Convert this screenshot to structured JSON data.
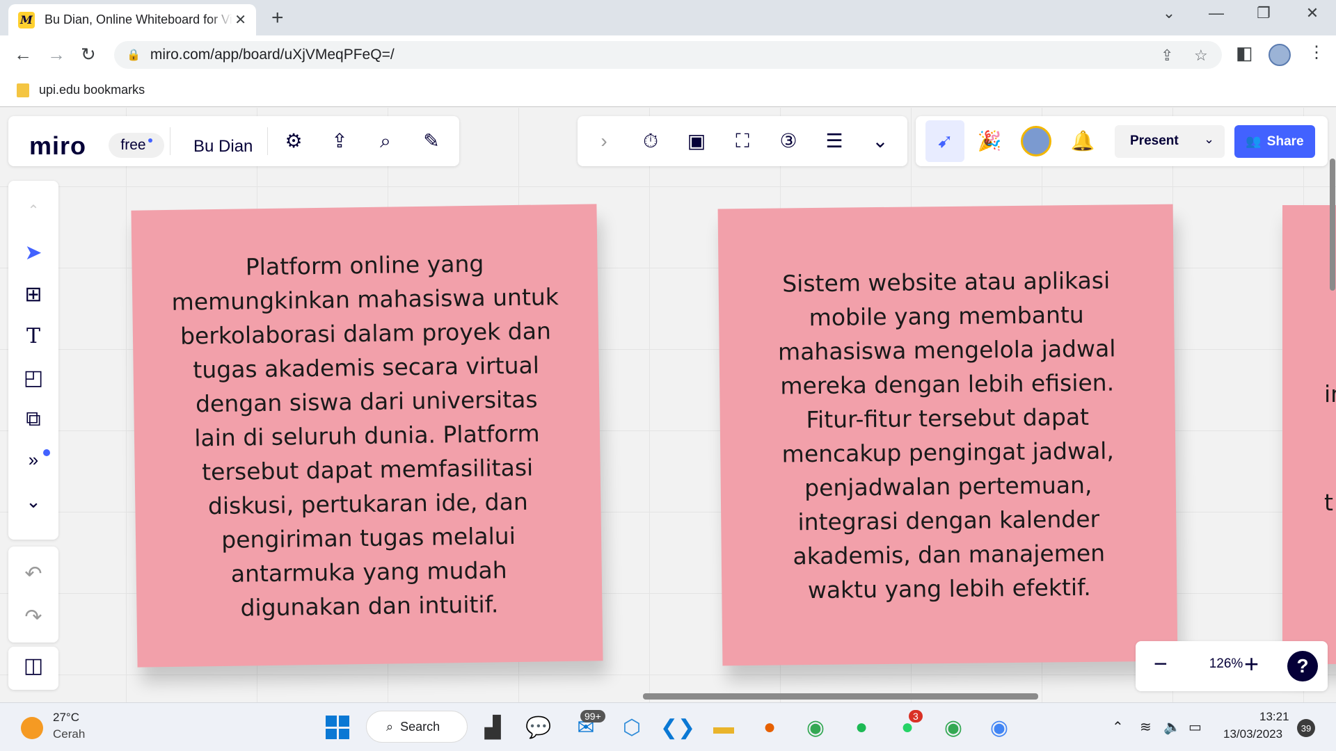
{
  "browser": {
    "tab_title": "Bu Dian, Online Whiteboard for Visual Collaboration",
    "tab_favicon": "M",
    "new_tab_icon": "+",
    "url": "miro.com/app/board/uXjVMeqPFeQ=/",
    "bookmark_folder": "upi.edu bookmarks"
  },
  "miro": {
    "logo": "miro",
    "plan_badge": "free",
    "board_name": "Bu Dian",
    "present_label": "Present",
    "share_label": "Share",
    "zoom_level": "126%",
    "help_label": "?",
    "accent_color": "#4262ff",
    "sticky_color": "#f2a0aa"
  },
  "stickies": [
    {
      "text": "Platform online yang memungkinkan mahasiswa untuk berkolaborasi dalam proyek dan tugas akademis secara virtual dengan siswa dari universitas lain di seluruh dunia. Platform tersebut dapat memfasilitasi diskusi, pertukaran ide, dan pengiriman tugas melalui antarmuka yang mudah digunakan dan intuitif."
    },
    {
      "text": "Sistem website atau aplikasi mobile yang membantu mahasiswa mengelola jadwal mereka dengan lebih efisien. Fitur-fitur tersebut dapat mencakup pengingat jadwal, penjadwalan pertemuan, integrasi dengan kalender akademis, dan manajemen waktu yang lebih efektif."
    },
    {
      "text_fragments": [
        "in",
        "t"
      ]
    }
  ],
  "taskbar": {
    "weather_temp": "27°C",
    "weather_desc": "Cerah",
    "search_label": "Search",
    "mail_badge": "99+",
    "whatsapp_badge": "3",
    "time": "13:21",
    "date": "13/03/2023",
    "notification_count": "39"
  }
}
